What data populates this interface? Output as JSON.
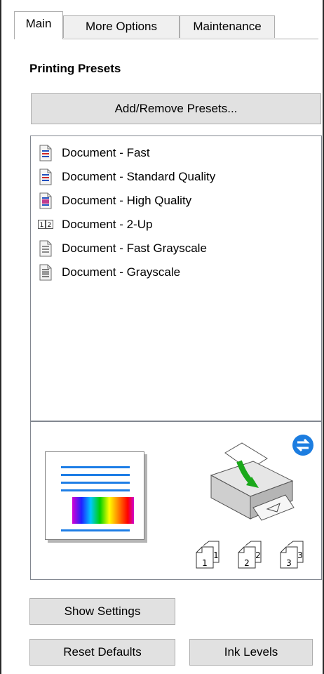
{
  "tabs": [
    {
      "label": "Main",
      "active": true
    },
    {
      "label": "More Options",
      "active": false
    },
    {
      "label": "Maintenance",
      "active": false
    }
  ],
  "section_title": "Printing Presets",
  "add_remove_label": "Add/Remove Presets...",
  "presets": [
    {
      "label": "Document - Fast",
      "icon": "document-color-icon"
    },
    {
      "label": "Document - Standard Quality",
      "icon": "document-color-icon"
    },
    {
      "label": "Document - High Quality",
      "icon": "document-photo-icon"
    },
    {
      "label": "Document - 2-Up",
      "icon": "two-up-icon"
    },
    {
      "label": "Document - Fast Grayscale",
      "icon": "document-gray-icon"
    },
    {
      "label": "Document - Grayscale",
      "icon": "document-gray-photo-icon"
    }
  ],
  "copies_labels": [
    "1",
    "1",
    "2",
    "2",
    "3",
    "3"
  ],
  "buttons": {
    "show_settings": "Show Settings",
    "reset_defaults": "Reset Defaults",
    "ink_levels": "Ink Levels"
  }
}
